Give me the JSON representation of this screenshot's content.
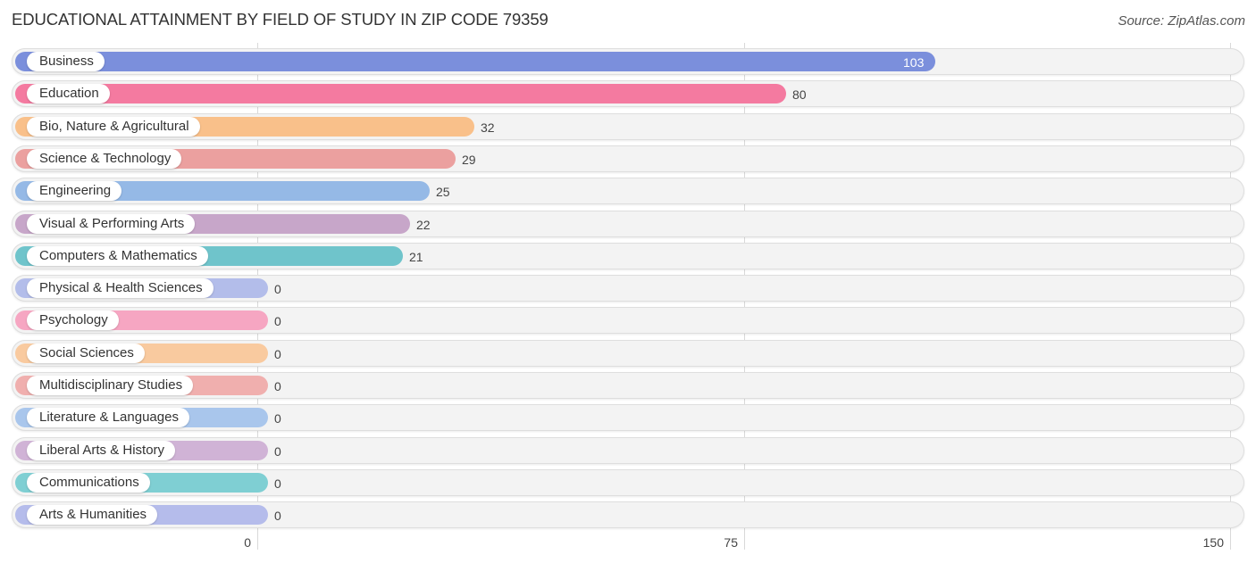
{
  "header": {
    "title": "EDUCATIONAL ATTAINMENT BY FIELD OF STUDY IN ZIP CODE 79359",
    "source": "Source: ZipAtlas.com"
  },
  "chart_data": {
    "type": "bar",
    "orientation": "horizontal",
    "title": "EDUCATIONAL ATTAINMENT BY FIELD OF STUDY IN ZIP CODE 79359",
    "xlabel": "",
    "ylabel": "",
    "xlim": [
      0,
      150
    ],
    "xticks": [
      0,
      75,
      150
    ],
    "xtick_labels": [
      "0",
      "75",
      "150"
    ],
    "grid": true,
    "legend": "none",
    "categories": [
      "Business",
      "Education",
      "Bio, Nature & Agricultural",
      "Science & Technology",
      "Engineering",
      "Visual & Performing Arts",
      "Computers & Mathematics",
      "Physical & Health Sciences",
      "Psychology",
      "Social Sciences",
      "Multidisciplinary Studies",
      "Literature & Languages",
      "Liberal Arts & History",
      "Communications",
      "Arts & Humanities"
    ],
    "values": [
      103,
      80,
      32,
      29,
      25,
      22,
      21,
      0,
      0,
      0,
      0,
      0,
      0,
      0,
      0
    ],
    "value_labels": [
      "103",
      "80",
      "32",
      "29",
      "25",
      "22",
      "21",
      "0",
      "0",
      "0",
      "0",
      "0",
      "0",
      "0",
      "0"
    ],
    "colors": [
      "#7b8fdc",
      "#f47aa0",
      "#f9c08a",
      "#eba09f",
      "#95b9e6",
      "#c7a6c9",
      "#6fc4cb",
      "#b3bdea",
      "#f6a6c2",
      "#f9ca9f",
      "#f0afae",
      "#a9c6ec",
      "#d0b3d6",
      "#7fcfd3",
      "#b5bceb"
    ]
  }
}
